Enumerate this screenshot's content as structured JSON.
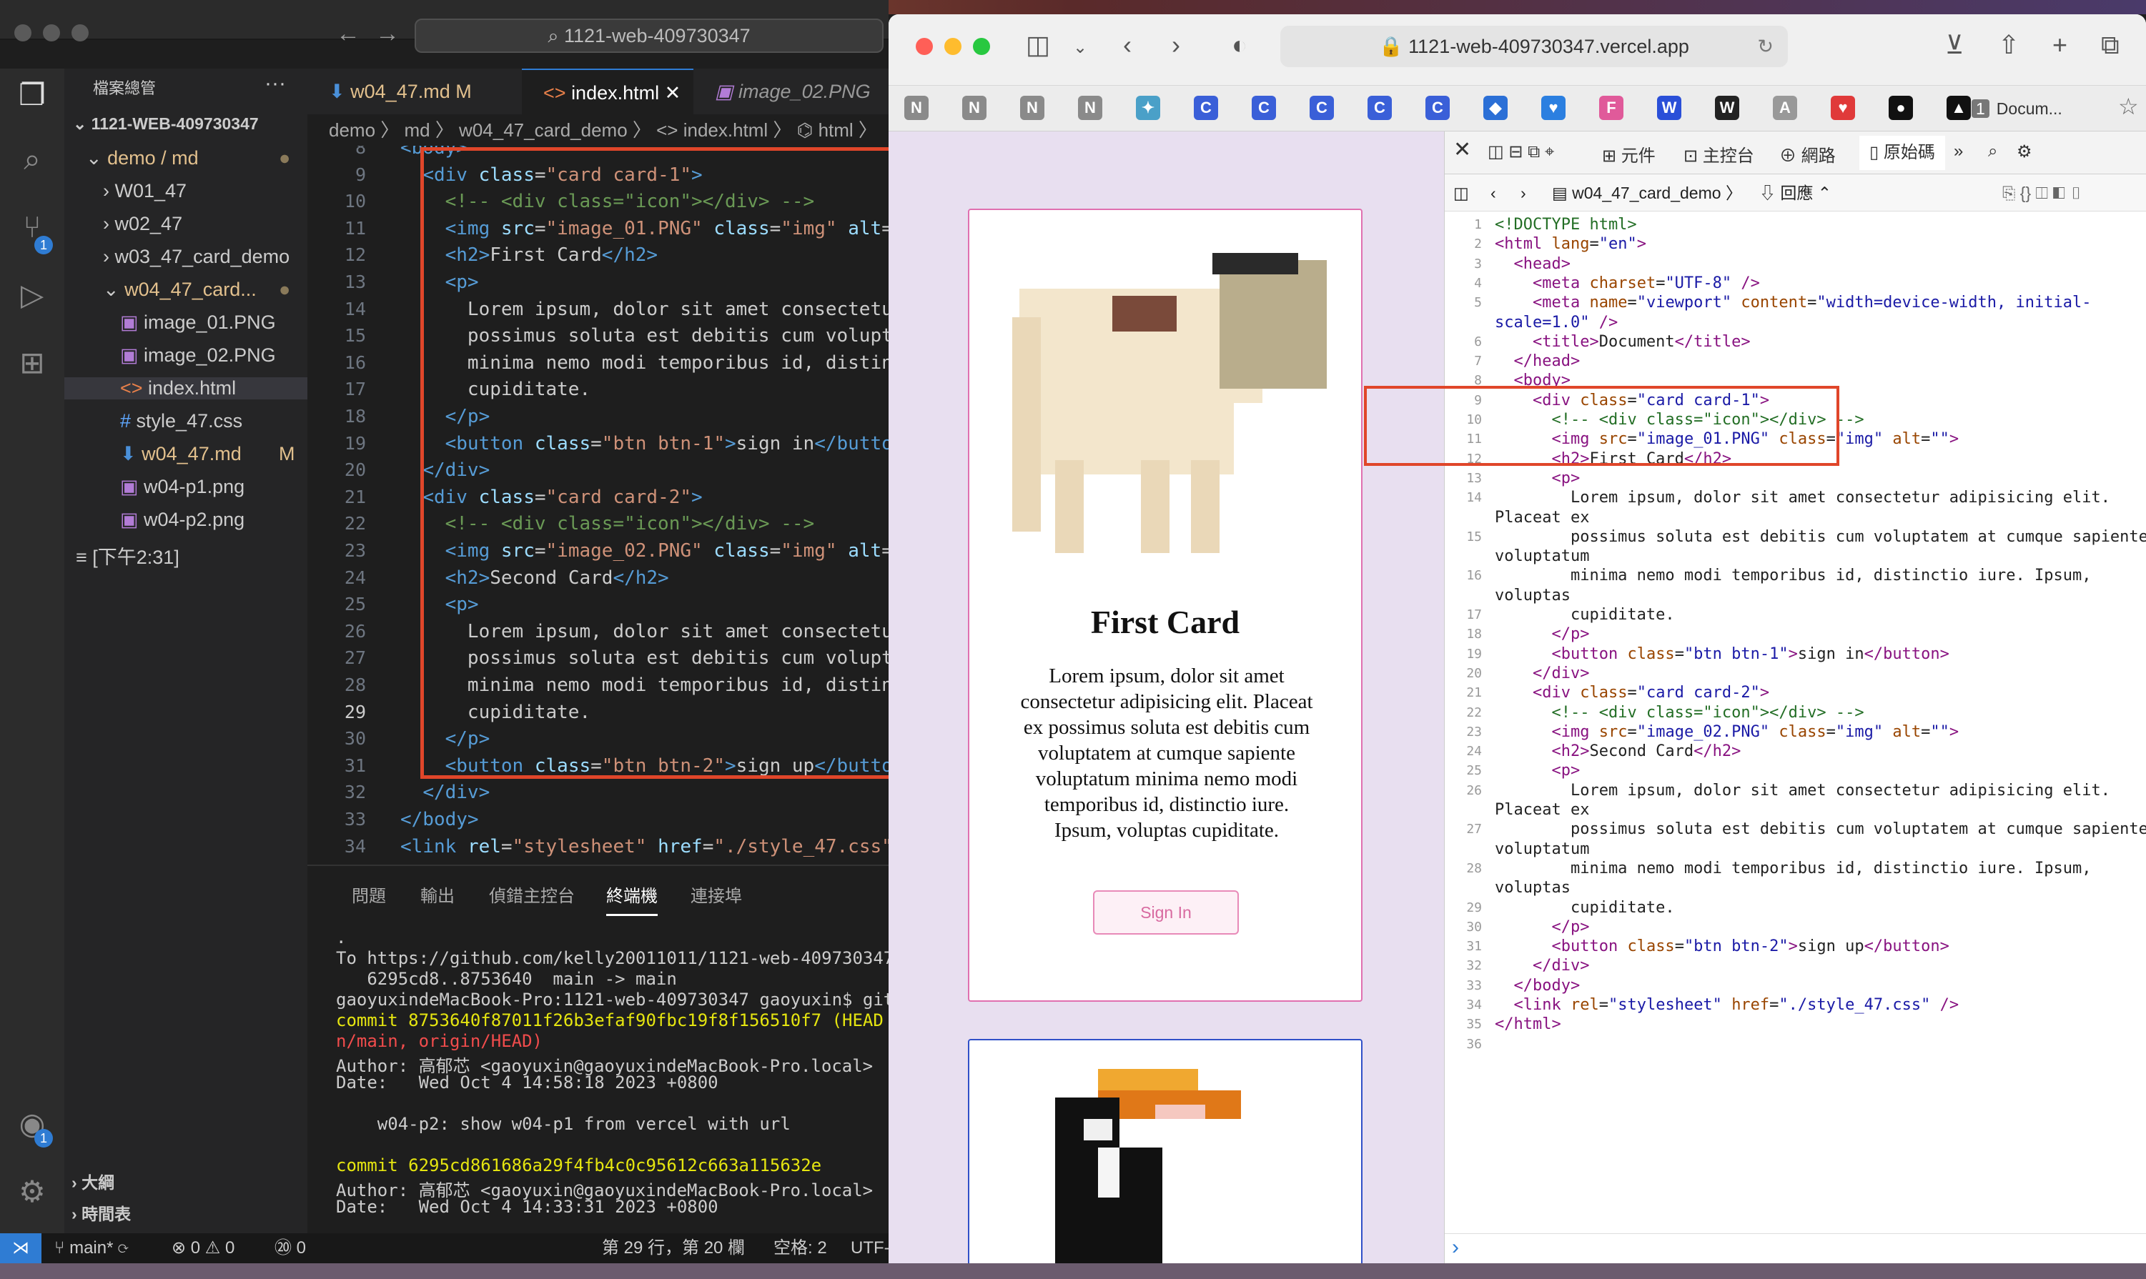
{
  "vscode": {
    "search": "1121-web-409730347",
    "sidebar": {
      "title": "檔案總管",
      "root": "1121-WEB-409730347",
      "items": [
        {
          "label": "demo / md",
          "kind": "folder-open",
          "level": 1,
          "modified": true
        },
        {
          "label": "W01_47",
          "kind": "folder",
          "level": 2
        },
        {
          "label": "w02_47",
          "kind": "folder",
          "level": 2
        },
        {
          "label": "w03_47_card_demo",
          "kind": "folder",
          "level": 2
        },
        {
          "label": "w04_47_card...",
          "kind": "folder-open",
          "level": 2,
          "modified": true
        },
        {
          "label": "image_01.PNG",
          "kind": "image",
          "level": 3
        },
        {
          "label": "image_02.PNG",
          "kind": "image",
          "level": 3
        },
        {
          "label": "index.html",
          "kind": "html",
          "level": 3,
          "selected": true
        },
        {
          "label": "style_47.css",
          "kind": "css",
          "level": 3
        },
        {
          "label": "w04_47.md",
          "kind": "markdown",
          "level": 3,
          "badge": "M"
        },
        {
          "label": "w04-p1.png",
          "kind": "image",
          "level": 3
        },
        {
          "label": "w04-p2.png",
          "kind": "image",
          "level": 3
        },
        {
          "label": "[下午2:31]",
          "kind": "timeline",
          "level": 1
        }
      ],
      "outline": "大綱",
      "timeline": "時間表"
    },
    "tabs": [
      {
        "label": "w04_47.md",
        "badge": "M"
      },
      {
        "label": "index.html",
        "active": true
      },
      {
        "label": "image_02.PNG"
      }
    ],
    "breadcrumb": "demo 〉 md 〉 w04_47_card_demo 〉 <> index.html 〉 ⌬ html 〉",
    "code_lines": [
      {
        "n": "8",
        "html": "<span class='tg'>&lt;body&gt;</span>"
      },
      {
        "n": "9",
        "html": "  <span class='tg'>&lt;div</span> <span class='at'>class</span>=<span class='st'>\"card card-1\"</span><span class='tg'>&gt;</span>"
      },
      {
        "n": "10",
        "html": "    <span class='cm'>&lt;!-- &lt;div class=\"icon\"&gt;&lt;/div&gt; --&gt;</span>"
      },
      {
        "n": "11",
        "html": "    <span class='tg'>&lt;img</span> <span class='at'>src</span>=<span class='st'>\"image_01.PNG\"</span> <span class='at'>class</span>=<span class='st'>\"img\"</span> <span class='at'>alt</span>=<span class='st'>\"</span>"
      },
      {
        "n": "12",
        "html": "    <span class='tg'>&lt;h2&gt;</span>First Card<span class='tg'>&lt;/h2&gt;</span>"
      },
      {
        "n": "13",
        "html": "    <span class='tg'>&lt;p&gt;</span>"
      },
      {
        "n": "14",
        "html": "      Lorem ipsum, dolor sit amet consectetur"
      },
      {
        "n": "15",
        "html": "      possimus soluta est debitis cum volupta"
      },
      {
        "n": "16",
        "html": "      minima nemo modi temporibus id, distinc"
      },
      {
        "n": "17",
        "html": "      cupiditate."
      },
      {
        "n": "18",
        "html": "    <span class='tg'>&lt;/p&gt;</span>"
      },
      {
        "n": "19",
        "html": "    <span class='tg'>&lt;button</span> <span class='at'>class</span>=<span class='st'>\"btn btn-1\"</span><span class='tg'>&gt;</span>sign in<span class='tg'>&lt;/button</span>"
      },
      {
        "n": "20",
        "html": "  <span class='tg'>&lt;/div&gt;</span>"
      },
      {
        "n": "21",
        "html": "  <span class='tg'>&lt;div</span> <span class='at'>class</span>=<span class='st'>\"card card-2\"</span><span class='tg'>&gt;</span>"
      },
      {
        "n": "22",
        "html": "    <span class='cm'>&lt;!-- &lt;div class=\"icon\"&gt;&lt;/div&gt; --&gt;</span>"
      },
      {
        "n": "23",
        "html": "    <span class='tg'>&lt;img</span> <span class='at'>src</span>=<span class='st'>\"image_02.PNG\"</span> <span class='at'>class</span>=<span class='st'>\"img\"</span> <span class='at'>alt</span>=<span class='st'>\"</span>"
      },
      {
        "n": "24",
        "html": "    <span class='tg'>&lt;h2&gt;</span>Second Card<span class='tg'>&lt;/h2&gt;</span>"
      },
      {
        "n": "25",
        "html": "    <span class='tg'>&lt;p&gt;</span>"
      },
      {
        "n": "26",
        "html": "      Lorem ipsum, dolor sit amet consectetur"
      },
      {
        "n": "27",
        "html": "      possimus soluta est debitis cum volupta"
      },
      {
        "n": "28",
        "html": "      minima nemo modi temporibus id, distinc"
      },
      {
        "n": "29",
        "html": "      cupiditate."
      },
      {
        "n": "30",
        "html": "    <span class='tg'>&lt;/p&gt;</span>"
      },
      {
        "n": "31",
        "html": "    <span class='tg'>&lt;button</span> <span class='at'>class</span>=<span class='st'>\"btn btn-2\"</span><span class='tg'>&gt;</span>sign up<span class='tg'>&lt;/button</span>"
      },
      {
        "n": "32",
        "html": "  <span class='tg'>&lt;/div&gt;</span>"
      },
      {
        "n": "33",
        "html": "<span class='tg'>&lt;/body&gt;</span>"
      },
      {
        "n": "34",
        "html": "<span class='tg'>&lt;link</span> <span class='at'>rel</span>=<span class='st'>\"stylesheet\"</span> <span class='at'>href</span>=<span class='st'>\"./style_47.css\"</span>"
      },
      {
        "n": "35",
        "html": "<span class='tg'>&lt;/html&gt;</span>"
      }
    ],
    "panel_tabs": [
      "問題",
      "輸出",
      "偵錯主控台",
      "終端機",
      "連接埠"
    ],
    "terminal": [
      {
        "text": ".",
        "cls": ""
      },
      {
        "text": "To https://github.com/kelly20011011/1121-web-409730347.",
        "cls": ""
      },
      {
        "text": "   6295cd8..8753640  main -> main",
        "cls": ""
      },
      {
        "text": "gaoyuxindeMacBook-Pro:1121-web-409730347 gaoyuxin$ git",
        "cls": ""
      },
      {
        "text": "commit 8753640f87011f26b3efaf90fbc19f8f156510f7 (HEAD -",
        "cls": "yel"
      },
      {
        "text": "n/main, origin/HEAD)",
        "cls": "red"
      },
      {
        "text": "Author: 高郁芯 <gaoyuxin@gaoyuxindeMacBook-Pro.local>",
        "cls": ""
      },
      {
        "text": "Date:   Wed Oct 4 14:58:18 2023 +0800",
        "cls": ""
      },
      {
        "text": "",
        "cls": ""
      },
      {
        "text": "    w04-p2: show w04-p1 from vercel with url",
        "cls": ""
      },
      {
        "text": "",
        "cls": ""
      },
      {
        "text": "commit 6295cd861686a29f4fb4c0c95612c663a115632e",
        "cls": "yel"
      },
      {
        "text": "Author: 高郁芯 <gaoyuxin@gaoyuxindeMacBook-Pro.local>",
        "cls": ""
      },
      {
        "text": "Date:   Wed Oct 4 14:33:31 2023 +0800",
        "cls": ""
      }
    ],
    "status": {
      "branch": "main*",
      "errors": "⊗ 0 ⚠ 0",
      "ports": "⑳ 0",
      "position": "第 29 行，第 20 欄",
      "spaces": "空格: 2",
      "encoding": "UTF-"
    }
  },
  "safari": {
    "url": "1121-web-409730347.vercel.app",
    "tab_label": "Docum...",
    "tab_count": "1",
    "favorites": [
      "N",
      "N",
      "N",
      "N",
      "✦",
      "C",
      "C",
      "C",
      "C",
      "C",
      "◆",
      "♥",
      "F",
      "W",
      "W",
      "A",
      "♥",
      "●",
      "▲"
    ],
    "card1": {
      "title": "First Card",
      "text": "Lorem ipsum, dolor sit amet consectetur adipisicing elit. Placeat ex possimus soluta est debitis cum voluptatem at cumque sapiente voluptatum minima nemo modi temporibus id, distinctio iure. Ipsum, voluptas cupiditate.",
      "button": "Sign In"
    }
  },
  "inspector": {
    "tabs": [
      "元件",
      "主控台",
      "網路",
      "原始碼"
    ],
    "active_tab": "原始碼",
    "breadcrumb": "w04_47_card_demo",
    "mode": "回應",
    "lines": [
      {
        "n": "1",
        "html": "<span class='s-cm'>&lt;!DOCTYPE html&gt;</span>"
      },
      {
        "n": "2",
        "html": "<span class='s-tg'>&lt;html</span> <span class='s-at'>lang</span>=<span class='s-st'>\"en\"</span><span class='s-tg'>&gt;</span>"
      },
      {
        "n": "3",
        "html": "  <span class='s-tg'>&lt;head&gt;</span>"
      },
      {
        "n": "4",
        "html": "    <span class='s-tg'>&lt;meta</span> <span class='s-at'>charset</span>=<span class='s-st'>\"UTF-8\"</span> <span class='s-tg'>/&gt;</span>"
      },
      {
        "n": "5",
        "html": "    <span class='s-tg'>&lt;meta</span> <span class='s-at'>name</span>=<span class='s-st'>\"viewport\"</span> <span class='s-at'>content</span>=<span class='s-st'>\"width=device-width, initial-</span>"
      },
      {
        "n": "",
        "html": "<span class='s-st'>scale=1.0\"</span> <span class='s-tg'>/&gt;</span>"
      },
      {
        "n": "6",
        "html": "    <span class='s-tg'>&lt;title&gt;</span>Document<span class='s-tg'>&lt;/title&gt;</span>"
      },
      {
        "n": "7",
        "html": "  <span class='s-tg'>&lt;/head&gt;</span>"
      },
      {
        "n": "8",
        "html": "  <span class='s-tg'>&lt;body&gt;</span>"
      },
      {
        "n": "9",
        "html": "    <span class='s-tg'>&lt;div</span> <span class='s-at'>class</span>=<span class='s-st'>\"card card-1\"</span><span class='s-tg'>&gt;</span>"
      },
      {
        "n": "10",
        "html": "      <span class='s-cm'>&lt;!-- &lt;div class=\"icon\"&gt;&lt;/div&gt; --&gt;</span>"
      },
      {
        "n": "11",
        "html": "      <span class='s-tg'>&lt;img</span> <span class='s-at'>src</span>=<span class='s-st'>\"image_01.PNG\"</span> <span class='s-at'>class</span>=<span class='s-st'>\"img\"</span> <span class='s-at'>alt</span>=<span class='s-st'>\"\"</span><span class='s-tg'>&gt;</span>"
      },
      {
        "n": "12",
        "html": "      <span class='s-tg'>&lt;h2&gt;</span>First Card<span class='s-tg'>&lt;/h2&gt;</span>"
      },
      {
        "n": "13",
        "html": "      <span class='s-tg'>&lt;p&gt;</span>"
      },
      {
        "n": "14",
        "html": "        Lorem ipsum, dolor sit amet consectetur adipisicing elit."
      },
      {
        "n": "",
        "html": "Placeat ex"
      },
      {
        "n": "15",
        "html": "        possimus soluta est debitis cum voluptatem at cumque sapiente"
      },
      {
        "n": "",
        "html": "voluptatum"
      },
      {
        "n": "16",
        "html": "        minima nemo modi temporibus id, distinctio iure. Ipsum,"
      },
      {
        "n": "",
        "html": "voluptas"
      },
      {
        "n": "17",
        "html": "        cupiditate."
      },
      {
        "n": "18",
        "html": "      <span class='s-tg'>&lt;/p&gt;</span>"
      },
      {
        "n": "19",
        "html": "      <span class='s-tg'>&lt;button</span> <span class='s-at'>class</span>=<span class='s-st'>\"btn btn-1\"</span><span class='s-tg'>&gt;</span>sign in<span class='s-tg'>&lt;/button&gt;</span>"
      },
      {
        "n": "20",
        "html": "    <span class='s-tg'>&lt;/div&gt;</span>"
      },
      {
        "n": "21",
        "html": "    <span class='s-tg'>&lt;div</span> <span class='s-at'>class</span>=<span class='s-st'>\"card card-2\"</span><span class='s-tg'>&gt;</span>"
      },
      {
        "n": "22",
        "html": "      <span class='s-cm'>&lt;!-- &lt;div class=\"icon\"&gt;&lt;/div&gt; --&gt;</span>"
      },
      {
        "n": "23",
        "html": "      <span class='s-tg'>&lt;img</span> <span class='s-at'>src</span>=<span class='s-st'>\"image_02.PNG\"</span> <span class='s-at'>class</span>=<span class='s-st'>\"img\"</span> <span class='s-at'>alt</span>=<span class='s-st'>\"\"</span><span class='s-tg'>&gt;</span>"
      },
      {
        "n": "24",
        "html": "      <span class='s-tg'>&lt;h2&gt;</span>Second Card<span class='s-tg'>&lt;/h2&gt;</span>"
      },
      {
        "n": "25",
        "html": "      <span class='s-tg'>&lt;p&gt;</span>"
      },
      {
        "n": "26",
        "html": "        Lorem ipsum, dolor sit amet consectetur adipisicing elit."
      },
      {
        "n": "",
        "html": "Placeat ex"
      },
      {
        "n": "27",
        "html": "        possimus soluta est debitis cum voluptatem at cumque sapiente"
      },
      {
        "n": "",
        "html": "voluptatum"
      },
      {
        "n": "28",
        "html": "        minima nemo modi temporibus id, distinctio iure. Ipsum,"
      },
      {
        "n": "",
        "html": "voluptas"
      },
      {
        "n": "29",
        "html": "        cupiditate."
      },
      {
        "n": "30",
        "html": "      <span class='s-tg'>&lt;/p&gt;</span>"
      },
      {
        "n": "31",
        "html": "      <span class='s-tg'>&lt;button</span> <span class='s-at'>class</span>=<span class='s-st'>\"btn btn-2\"</span><span class='s-tg'>&gt;</span>sign up<span class='s-tg'>&lt;/button&gt;</span>"
      },
      {
        "n": "32",
        "html": "    <span class='s-tg'>&lt;/div&gt;</span>"
      },
      {
        "n": "33",
        "html": "  <span class='s-tg'>&lt;/body&gt;</span>"
      },
      {
        "n": "34",
        "html": "  <span class='s-tg'>&lt;link</span> <span class='s-at'>rel</span>=<span class='s-st'>\"stylesheet\"</span> <span class='s-at'>href</span>=<span class='s-st'>\"./style_47.css\"</span> <span class='s-tg'>/&gt;</span>"
      },
      {
        "n": "35",
        "html": "<span class='s-tg'>&lt;/html&gt;</span>"
      },
      {
        "n": "36",
        "html": ""
      }
    ],
    "console_prompt": "›"
  }
}
